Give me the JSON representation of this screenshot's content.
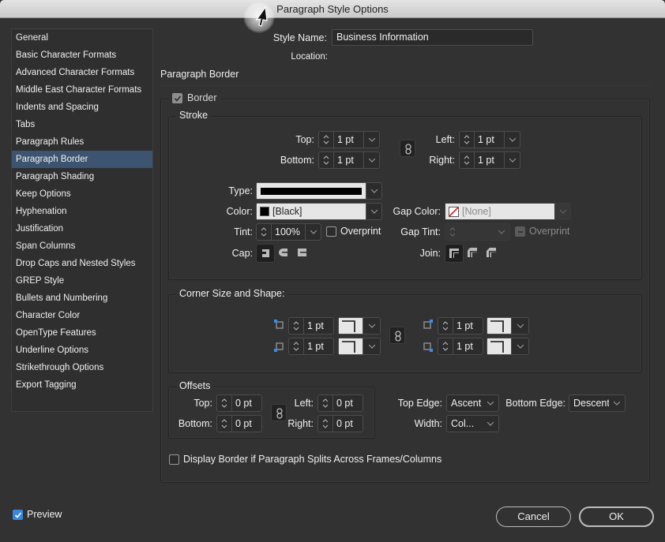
{
  "window": {
    "title": "Paragraph Style Options"
  },
  "sidebar": {
    "selected_index": 7,
    "items": [
      {
        "label": "General"
      },
      {
        "label": "Basic Character Formats"
      },
      {
        "label": "Advanced Character Formats"
      },
      {
        "label": "Middle East Character Formats"
      },
      {
        "label": "Indents and Spacing"
      },
      {
        "label": "Tabs"
      },
      {
        "label": "Paragraph Rules"
      },
      {
        "label": "Paragraph Border"
      },
      {
        "label": "Paragraph Shading"
      },
      {
        "label": "Keep Options"
      },
      {
        "label": "Hyphenation"
      },
      {
        "label": "Justification"
      },
      {
        "label": "Span Columns"
      },
      {
        "label": "Drop Caps and Nested Styles"
      },
      {
        "label": "GREP Style"
      },
      {
        "label": "Bullets and Numbering"
      },
      {
        "label": "Character Color"
      },
      {
        "label": "OpenType Features"
      },
      {
        "label": "Underline Options"
      },
      {
        "label": "Strikethrough Options"
      },
      {
        "label": "Export Tagging"
      }
    ]
  },
  "header": {
    "style_name_label": "Style Name:",
    "style_name_value": "Business Information",
    "location_label": "Location:",
    "section_title": "Paragraph Border"
  },
  "border": {
    "checkbox_label": "Border",
    "checked": true,
    "stroke": {
      "legend": "Stroke",
      "top_label": "Top:",
      "top_value": "1 pt",
      "bottom_label": "Bottom:",
      "bottom_value": "1 pt",
      "left_label": "Left:",
      "left_value": "1 pt",
      "right_label": "Right:",
      "right_value": "1 pt",
      "type_label": "Type:",
      "type_value": "solid",
      "color_label": "Color:",
      "color_value": "[Black]",
      "color_swatch": "#000000",
      "gap_color_label": "Gap Color:",
      "gap_color_value": "[None]",
      "tint_label": "Tint:",
      "tint_value": "100%",
      "overprint_label": "Overprint",
      "gap_tint_label": "Gap Tint:",
      "gap_tint_value": "",
      "gap_overprint_label": "Overprint",
      "cap_label": "Cap:",
      "cap_options": [
        "butt-cap-icon",
        "round-cap-icon",
        "projecting-cap-icon"
      ],
      "join_label": "Join:",
      "join_options": [
        "miter-join-icon",
        "round-join-icon",
        "bevel-join-icon"
      ]
    },
    "corners": {
      "legend": "Corner Size and Shape:",
      "top_left_value": "1 pt",
      "bottom_left_value": "1 pt",
      "top_right_value": "1 pt",
      "bottom_right_value": "1 pt"
    },
    "offsets": {
      "legend": "Offsets",
      "top_label": "Top:",
      "top_value": "0 pt",
      "bottom_label": "Bottom:",
      "bottom_value": "0 pt",
      "left_label": "Left:",
      "left_value": "0 pt",
      "right_label": "Right:",
      "right_value": "0 pt"
    },
    "top_edge_label": "Top Edge:",
    "top_edge_value": "Ascent",
    "bottom_edge_label": "Bottom Edge:",
    "bottom_edge_value": "Descent",
    "width_label": "Width:",
    "width_value": "Col...",
    "split_label": "Display Border if Paragraph Splits Across Frames/Columns",
    "split_checked": false
  },
  "footer": {
    "preview_label": "Preview",
    "preview_checked": true,
    "cancel_label": "Cancel",
    "ok_label": "OK"
  },
  "colors": {
    "selected_item": "#3c5470",
    "checkbox_blue": "#3b87e0",
    "corner_indicator": "#3b8ee8"
  }
}
